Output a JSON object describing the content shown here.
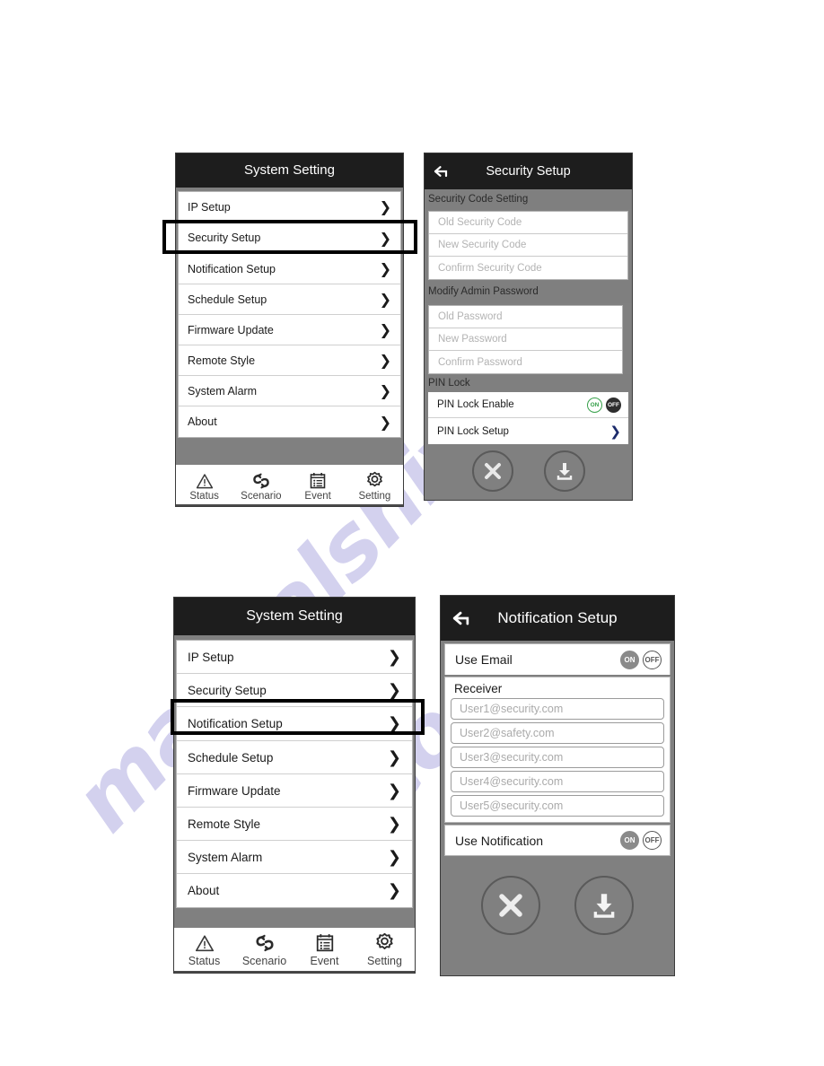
{
  "watermark": {
    "line1": "manualshive",
    "line2": ".com"
  },
  "screens": {
    "system_setting_top": {
      "title": "System Setting",
      "menu_items": [
        {
          "label": "IP Setup"
        },
        {
          "label": "Security Setup"
        },
        {
          "label": "Notification Setup"
        },
        {
          "label": "Schedule Setup"
        },
        {
          "label": "Firmware Update"
        },
        {
          "label": "Remote Style"
        },
        {
          "label": "System Alarm"
        },
        {
          "label": "About"
        }
      ],
      "highlighted_item": "Security Setup",
      "chevron": "❯",
      "nav": [
        {
          "label": "Status",
          "icon": "warning-triangle-icon"
        },
        {
          "label": "Scenario",
          "icon": "scenario-link-icon"
        },
        {
          "label": "Event",
          "icon": "calendar-list-icon"
        },
        {
          "label": "Setting",
          "icon": "gear-icon"
        }
      ]
    },
    "security_setup": {
      "title": "Security Setup",
      "back_icon": "⬅",
      "sections": [
        {
          "header": "Security Code Setting",
          "fields": [
            {
              "placeholder": "Old Security Code"
            },
            {
              "placeholder": "New Security Code"
            },
            {
              "placeholder": "Confirm Security Code"
            }
          ]
        },
        {
          "header": "Modify Admin Password",
          "fields": [
            {
              "placeholder": "Old Password"
            },
            {
              "placeholder": "New Password"
            },
            {
              "placeholder": "Confirm Password"
            }
          ]
        }
      ],
      "pin_lock": {
        "header": "PIN Lock",
        "enable_label": "PIN Lock Enable",
        "on_label": "ON",
        "off_label": "OFF",
        "selected": "OFF",
        "setup_label": "PIN Lock Setup",
        "chevron": "❯"
      },
      "actions": {
        "cancel": "cancel-icon",
        "save": "save-download-icon"
      }
    },
    "system_setting_bottom": {
      "title": "System Setting",
      "menu_items": [
        {
          "label": "IP Setup"
        },
        {
          "label": "Security Setup"
        },
        {
          "label": "Notification Setup"
        },
        {
          "label": "Schedule Setup"
        },
        {
          "label": "Firmware Update"
        },
        {
          "label": "Remote Style"
        },
        {
          "label": "System Alarm"
        },
        {
          "label": "About"
        }
      ],
      "highlighted_item": "Notification Setup",
      "chevron": "❯",
      "nav": [
        {
          "label": "Status",
          "icon": "warning-triangle-icon"
        },
        {
          "label": "Scenario",
          "icon": "scenario-link-icon"
        },
        {
          "label": "Event",
          "icon": "calendar-list-icon"
        },
        {
          "label": "Setting",
          "icon": "gear-icon"
        }
      ]
    },
    "notification_setup": {
      "title": "Notification Setup",
      "back_icon": "⬅",
      "use_email": {
        "label": "Use Email",
        "on_label": "ON",
        "off_label": "OFF",
        "selected": "ON"
      },
      "receiver": {
        "header": "Receiver",
        "fields": [
          {
            "placeholder": "User1@security.com"
          },
          {
            "placeholder": "User2@safety.com"
          },
          {
            "placeholder": "User3@security.com"
          },
          {
            "placeholder": "User4@security.com"
          },
          {
            "placeholder": "User5@security.com"
          }
        ]
      },
      "use_notification": {
        "label": "Use Notification",
        "on_label": "ON",
        "off_label": "OFF",
        "selected": "ON"
      },
      "actions": {
        "cancel": "cancel-icon",
        "save": "save-download-icon"
      }
    }
  },
  "colors": {
    "titlebar_bg": "#1d1d1d",
    "screen_bg": "#808080",
    "row_bg": "#ffffff",
    "toggle_on_green": "#37a04a",
    "toggle_off_dark": "#2e2e2e",
    "highlight_border": "#000000",
    "watermark": "#b9b6e4"
  }
}
